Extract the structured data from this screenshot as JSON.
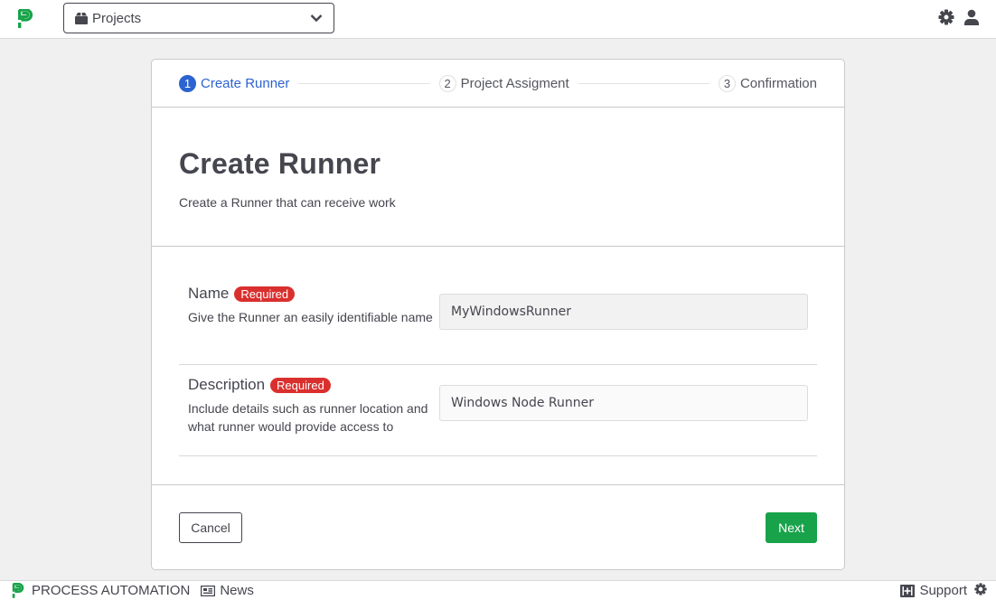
{
  "topbar": {
    "logo": "process-automation-logo",
    "project_select": {
      "value": "Projects",
      "icon": "box-icon"
    },
    "icons": [
      "gear-icon",
      "user-icon"
    ]
  },
  "wizard": {
    "steps": [
      {
        "number": "1",
        "label": "Create Runner",
        "active": true
      },
      {
        "number": "2",
        "label": "Project Assigment",
        "active": false
      },
      {
        "number": "3",
        "label": "Confirmation",
        "active": false
      }
    ],
    "title": "Create Runner",
    "subtitle": "Create a Runner that can receive work",
    "fields": [
      {
        "label": "Name",
        "badge": "Required",
        "help": "Give the Runner an easily identifiable name",
        "value": "MyWindowsRunner"
      },
      {
        "label": "Description",
        "badge": "Required",
        "help": "Include details such as runner location and what runner would provide access to",
        "value": "Windows Node Runner"
      }
    ],
    "cancel_label": "Cancel",
    "next_label": "Next"
  },
  "bottombar": {
    "brand": "PROCESS AUTOMATION",
    "news_label": "News",
    "support_label": "Support"
  },
  "colors": {
    "brand_green": "#18a34a",
    "active_step_blue": "#2c63d0",
    "required_red": "#d9302e"
  }
}
